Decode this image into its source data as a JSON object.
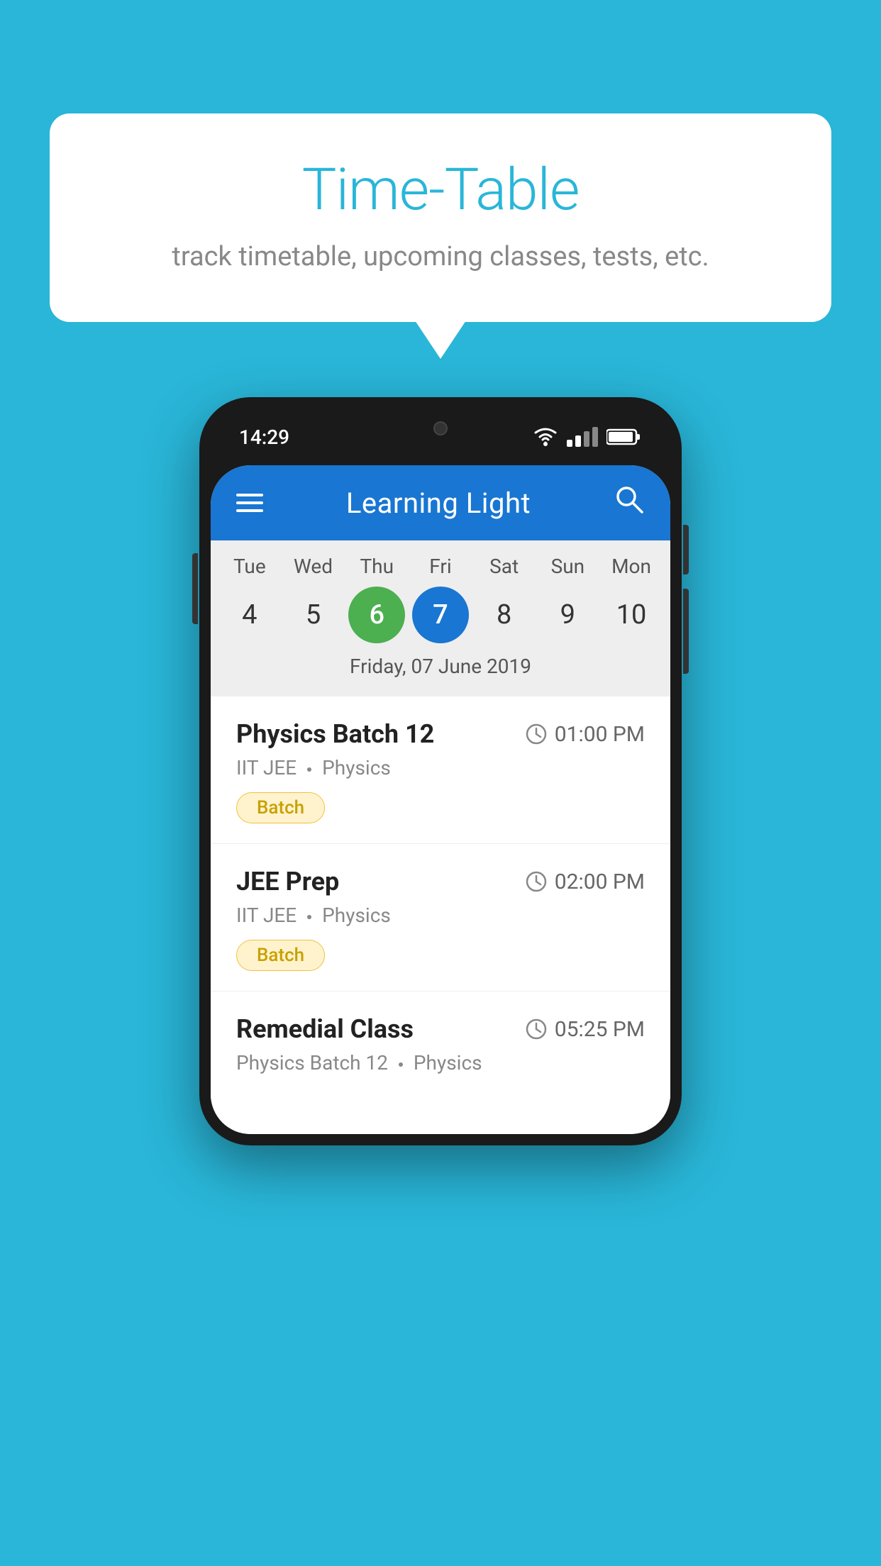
{
  "background": {
    "color": "#29B6D8"
  },
  "speech_bubble": {
    "title": "Time-Table",
    "subtitle": "track timetable, upcoming classes, tests, etc."
  },
  "phone": {
    "status_bar": {
      "time": "14:29"
    },
    "app_bar": {
      "title": "Learning Light"
    },
    "calendar": {
      "days": [
        {
          "label": "Tue",
          "number": "4"
        },
        {
          "label": "Wed",
          "number": "5"
        },
        {
          "label": "Thu",
          "number": "6",
          "state": "today"
        },
        {
          "label": "Fri",
          "number": "7",
          "state": "selected"
        },
        {
          "label": "Sat",
          "number": "8"
        },
        {
          "label": "Sun",
          "number": "9"
        },
        {
          "label": "Mon",
          "number": "10"
        }
      ],
      "selected_date_label": "Friday, 07 June 2019"
    },
    "schedule": [
      {
        "title": "Physics Batch 12",
        "time": "01:00 PM",
        "subtitle_course": "IIT JEE",
        "subtitle_subject": "Physics",
        "badge": "Batch"
      },
      {
        "title": "JEE Prep",
        "time": "02:00 PM",
        "subtitle_course": "IIT JEE",
        "subtitle_subject": "Physics",
        "badge": "Batch"
      },
      {
        "title": "Remedial Class",
        "time": "05:25 PM",
        "subtitle_course": "Physics Batch 12",
        "subtitle_subject": "Physics",
        "badge": ""
      }
    ]
  }
}
